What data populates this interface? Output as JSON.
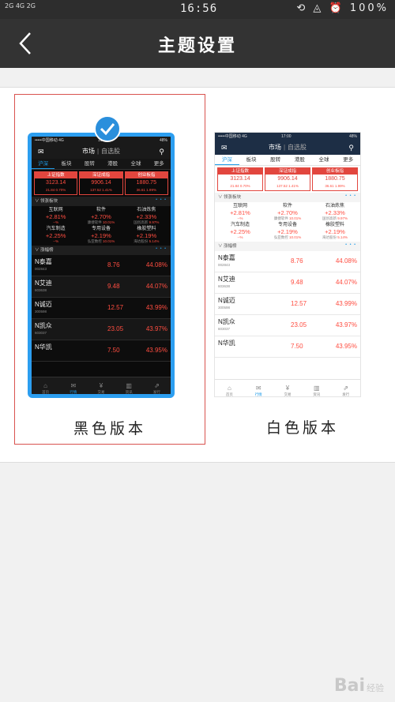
{
  "status_bar": {
    "signal_text": "2G 4G 2G",
    "time": "16:56",
    "right_icons": "⟲ ◬ ⏰ 100%"
  },
  "header": {
    "title": "主题设置"
  },
  "themes": {
    "dark": {
      "label": "黑色版本"
    },
    "light": {
      "label": "白色版本"
    }
  },
  "preview": {
    "status_left": "•••••中国移动 4G",
    "status_time": "17:00",
    "status_right": "48%",
    "dark_status_time": "16:59",
    "nav_title": "市场",
    "nav_sub": "自选股",
    "tabs": [
      "沪深",
      "板块",
      "股转",
      "港股",
      "全球",
      "更多"
    ],
    "indices": [
      {
        "name": "上证指数",
        "value": "3123.14",
        "change": "21.84  0.70%"
      },
      {
        "name": "深证成指",
        "value": "9906.14",
        "change": "137.52  1.41%"
      },
      {
        "name": "创业板指",
        "value": "1880.75",
        "change": "36.61  1.99%"
      }
    ],
    "sector_title": "领涨板块",
    "sectors": [
      {
        "name": "互联网",
        "pct": "+2.81%",
        "sub_name": "",
        "sub_pct": "--%"
      },
      {
        "name": "软件",
        "pct": "+2.70%",
        "sub_name": "康捷软件",
        "sub_pct": "10.01%"
      },
      {
        "name": "石油炼焦",
        "pct": "+2.33%",
        "sub_name": "国创高新",
        "sub_pct": "9.97%"
      },
      {
        "name": "汽车制造",
        "pct": "+2.25%",
        "sub_name": "",
        "sub_pct": "--%"
      },
      {
        "name": "专用设备",
        "pct": "+2.19%",
        "sub_name": "弘亚数控",
        "sub_pct": "10.01%"
      },
      {
        "name": "橡胶塑料",
        "pct": "+2.19%",
        "sub_name": "海达股份",
        "sub_pct": "5.14%"
      }
    ],
    "list_title": "涨幅榜",
    "stocks": [
      {
        "name": "N泰嘉",
        "code": "002843",
        "price": "8.76",
        "pct": "44.08%"
      },
      {
        "name": "N艾迪",
        "code": "603638",
        "price": "9.48",
        "pct": "44.07%"
      },
      {
        "name": "N诚迈",
        "code": "300598",
        "price": "12.57",
        "pct": "43.99%"
      },
      {
        "name": "N凯众",
        "code": "603037",
        "price": "23.05",
        "pct": "43.97%"
      },
      {
        "name": "N华凯",
        "code": "",
        "price": "7.50",
        "pct": "43.95%"
      }
    ],
    "bottom_tabs": [
      "首页",
      "行情",
      "交易",
      "资讯",
      "发行"
    ]
  },
  "watermark": {
    "logo": "Bai",
    "sub": "经验"
  },
  "colors": {
    "accent_blue": "#1e9be8",
    "up_red": "#e2463e",
    "header_bg": "#333333",
    "selected_border": "#d9534f"
  }
}
